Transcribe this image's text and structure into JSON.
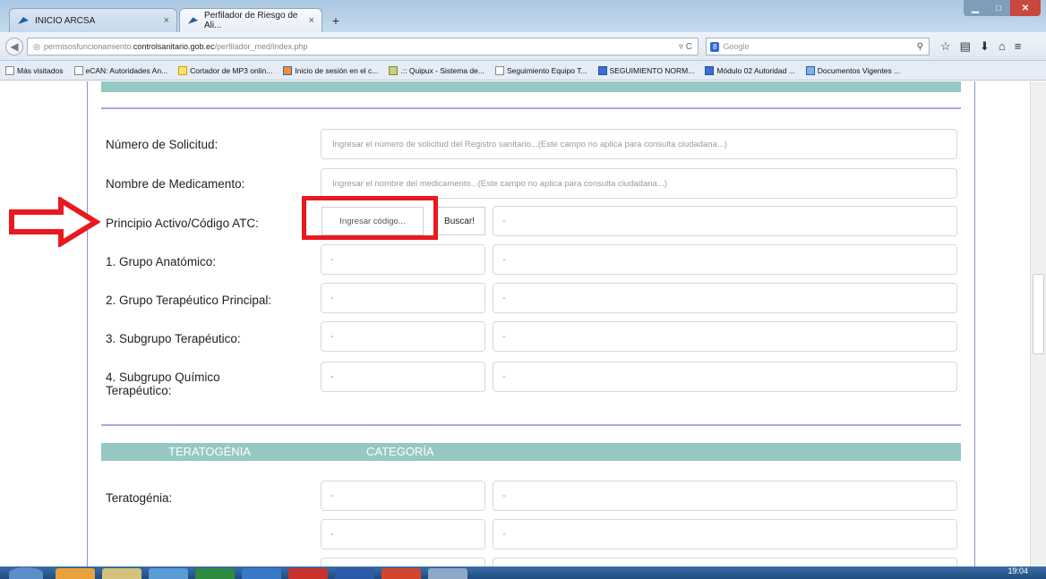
{
  "browser": {
    "tabs": [
      {
        "label": "INICIO ARCSA",
        "close": "×"
      },
      {
        "label": "Perfilador de Riesgo de Ali...",
        "close": "×"
      }
    ],
    "new_tab": "+",
    "url_prefix": "permisosfuncionamiento.",
    "url_host": "controlsanitario.gob.ec",
    "url_path": "/perfilador_med/index.php",
    "url_controls": "▿ C",
    "search_engine": "8",
    "search_placeholder": "Google",
    "bookmarks": [
      "Más visitados",
      "eCAN: Autoridades An...",
      "Cortador de MP3 onlin...",
      "Inicio de sesión en el c...",
      ".:: Quipux - Sistema de...",
      "Seguimiento Equipo T...",
      "SEGUIMIENTO NORM...",
      "Módulo 02 Autoridad ...",
      "Documentos Vigentes ..."
    ]
  },
  "form": {
    "numero_label": "Número de Solicitud:",
    "numero_placeholder": "Ingresar el número de solicitud del Registro sanitario...(Este campo no aplica para consulta ciudadana...)",
    "nombre_label": "Nombre de Medicamento:",
    "nombre_placeholder": "Ingresar el nombre del medicamento...(Este campo no aplica para consulta ciudadana...)",
    "principio_label": "Principio Activo/Código ATC:",
    "codigo_button": "Ingresar código...",
    "buscar_button": "Buscar!",
    "dash": "-",
    "grupo1_label": "1. Grupo Anatómico:",
    "grupo2_label": "2. Grupo Terapéutico Principal:",
    "grupo3_label": "3. Subgrupo Terapéutico:",
    "grupo4_label_line1": "4. Subgrupo Químico",
    "grupo4_label_line2": "Terapéutico:",
    "section_col1": "TERATOGÉNIA",
    "section_col2": "CATEGORÍA",
    "teratogenia_label": "Teratogénia:"
  },
  "taskbar": {
    "clock": "19:04"
  },
  "colors": {
    "accent_teal": "#96c8c3",
    "divider": "#a8a8e4",
    "highlight_red": "#e8191f"
  }
}
